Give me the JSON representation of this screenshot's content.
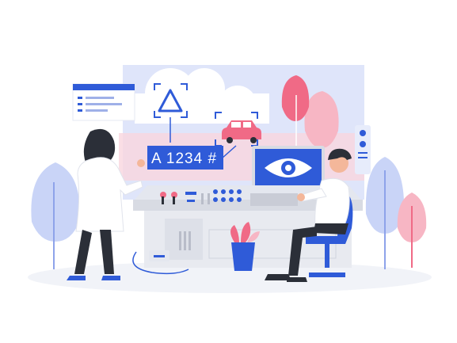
{
  "scene": {
    "plate_text": "A 1234 #"
  },
  "palette": {
    "blue": "#2f5bd8",
    "light_blue": "#c9d4f7",
    "pale_blue": "#e7ecfb",
    "pink": "#f06a86",
    "light_pink": "#f7b6c4",
    "grey": "#d8dbe3",
    "dark": "#2b2f38"
  },
  "icons": {
    "camera_eye": "eye-icon",
    "warning": "warning-triangle-icon",
    "car": "car-icon",
    "browser": "browser-window-icon"
  }
}
